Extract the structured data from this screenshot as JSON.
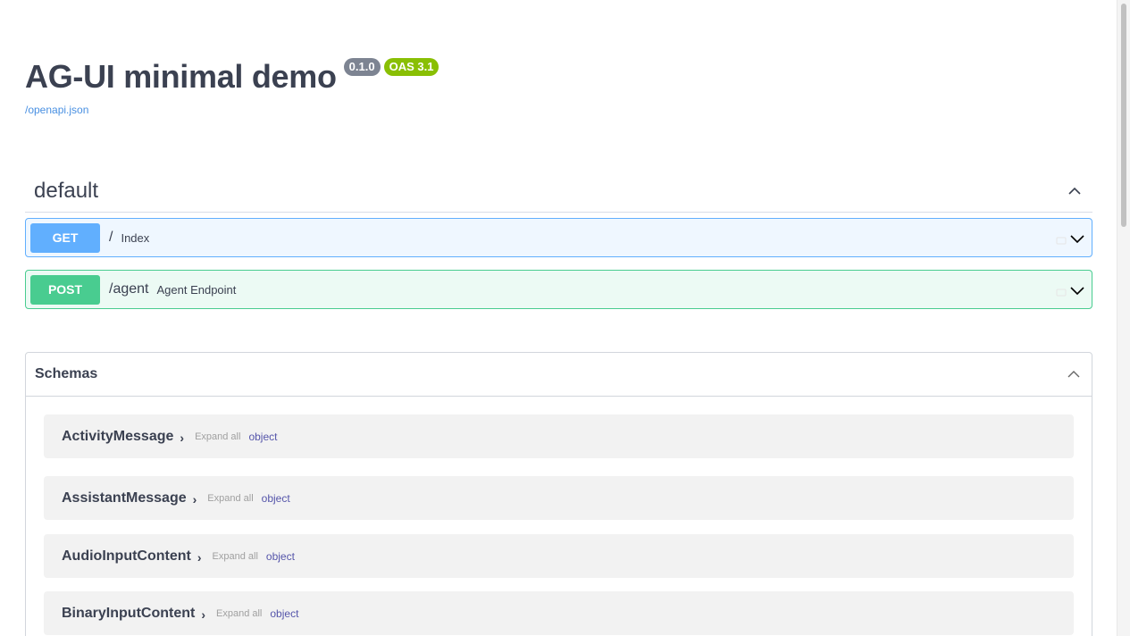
{
  "info": {
    "title": "AG-UI minimal demo",
    "version": "0.1.0",
    "oas": "OAS 3.1",
    "spec_link": "/openapi.json"
  },
  "tag": {
    "name": "default"
  },
  "operations": [
    {
      "method": "GET",
      "path": "/",
      "summary": "Index"
    },
    {
      "method": "POST",
      "path": "/agent",
      "summary": "Agent Endpoint"
    }
  ],
  "schemas": {
    "title": "Schemas",
    "models": [
      {
        "name": "ActivityMessage",
        "expand": "Expand all",
        "type": "object"
      },
      {
        "name": "AssistantMessage",
        "expand": "Expand all",
        "type": "object"
      },
      {
        "name": "AudioInputContent",
        "expand": "Expand all",
        "type": "object"
      },
      {
        "name": "BinaryInputContent",
        "expand": "Expand all",
        "type": "object"
      }
    ]
  },
  "icons": {
    "model_arrow": "chevron-right-icon",
    "collapse": "chevron-up-icon",
    "expand": "chevron-down-icon",
    "lock": "lock-icon"
  },
  "colors": {
    "get": "#61affe",
    "post": "#49cc90",
    "version_badge": "#7d8492",
    "oas_badge": "#89bf04",
    "link": "#4990e2"
  }
}
